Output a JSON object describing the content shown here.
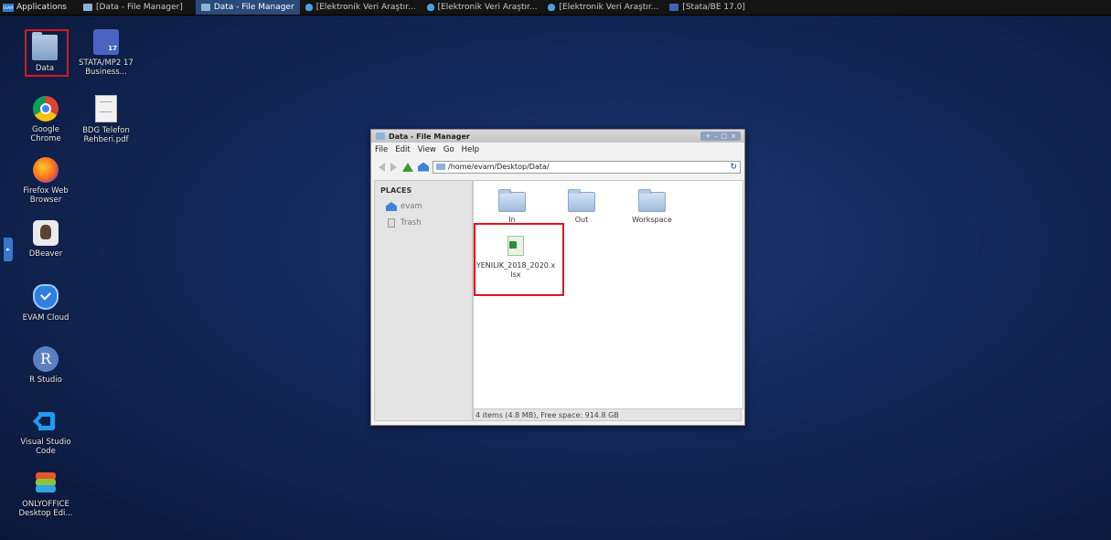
{
  "taskbar": {
    "logo_text": "EVAM",
    "applications_label": "Applications",
    "tasks": [
      {
        "label": "[Data - File Manager]",
        "icon": "folder-icon"
      },
      {
        "label": "Data - File Manager",
        "icon": "folder-icon",
        "active": true
      },
      {
        "label": "[Elektronik Veri Araştır...",
        "icon": "shield-icon"
      },
      {
        "label": "[Elektronik Veri Araştır...",
        "icon": "shield-icon"
      },
      {
        "label": "[Elektronik Veri Araştır...",
        "icon": "shield-icon"
      },
      {
        "label": "[Stata/BE 17.0]",
        "icon": "stata-icon"
      }
    ]
  },
  "desktop": {
    "icons": [
      {
        "name": "Data",
        "icon": "folder-icon"
      },
      {
        "name": "STATA/MP2 17 Business...",
        "icon": "stata-icon",
        "badge": "17"
      },
      {
        "name": "Google Chrome",
        "icon": "chrome-icon"
      },
      {
        "name": "BDG Telefon Rehberi.pdf",
        "icon": "pdf-file-icon"
      },
      {
        "name": "Firefox Web Browser",
        "icon": "firefox-icon"
      },
      {
        "name": "DBeaver",
        "icon": "dbeaver-icon"
      },
      {
        "name": "EVAM Cloud",
        "icon": "evam-cloud-icon"
      },
      {
        "name": "R Studio",
        "icon": "r-studio-icon",
        "glyph": "R"
      },
      {
        "name": "Visual Studio Code",
        "icon": "vscode-icon"
      },
      {
        "name": "ONLYOFFICE Desktop Edi...",
        "icon": "onlyoffice-icon"
      }
    ],
    "side_handle": "▸"
  },
  "file_manager": {
    "title": "Data - File Manager",
    "controls": [
      "+",
      "–",
      "□",
      "×"
    ],
    "menu": [
      "File",
      "Edit",
      "View",
      "Go",
      "Help"
    ],
    "path": "/home/evam/Desktop/Data/",
    "reload_glyph": "↻",
    "places_header": "PLACES",
    "places": [
      "evam",
      "Trash"
    ],
    "items": [
      {
        "name": "In",
        "type": "folder"
      },
      {
        "name": "Out",
        "type": "folder"
      },
      {
        "name": "Workspace",
        "type": "folder"
      },
      {
        "name": "YENILIK_2018_2020.xlsx",
        "type": "spreadsheet"
      }
    ],
    "status": "4 items (4.8 MB), Free space: 914.8 GB"
  },
  "colors": {
    "highlight_box": "#e0141e",
    "desktop_bg": "#13285a",
    "taskbar_bg": "#141414",
    "active_task": "#2a4a7a"
  }
}
